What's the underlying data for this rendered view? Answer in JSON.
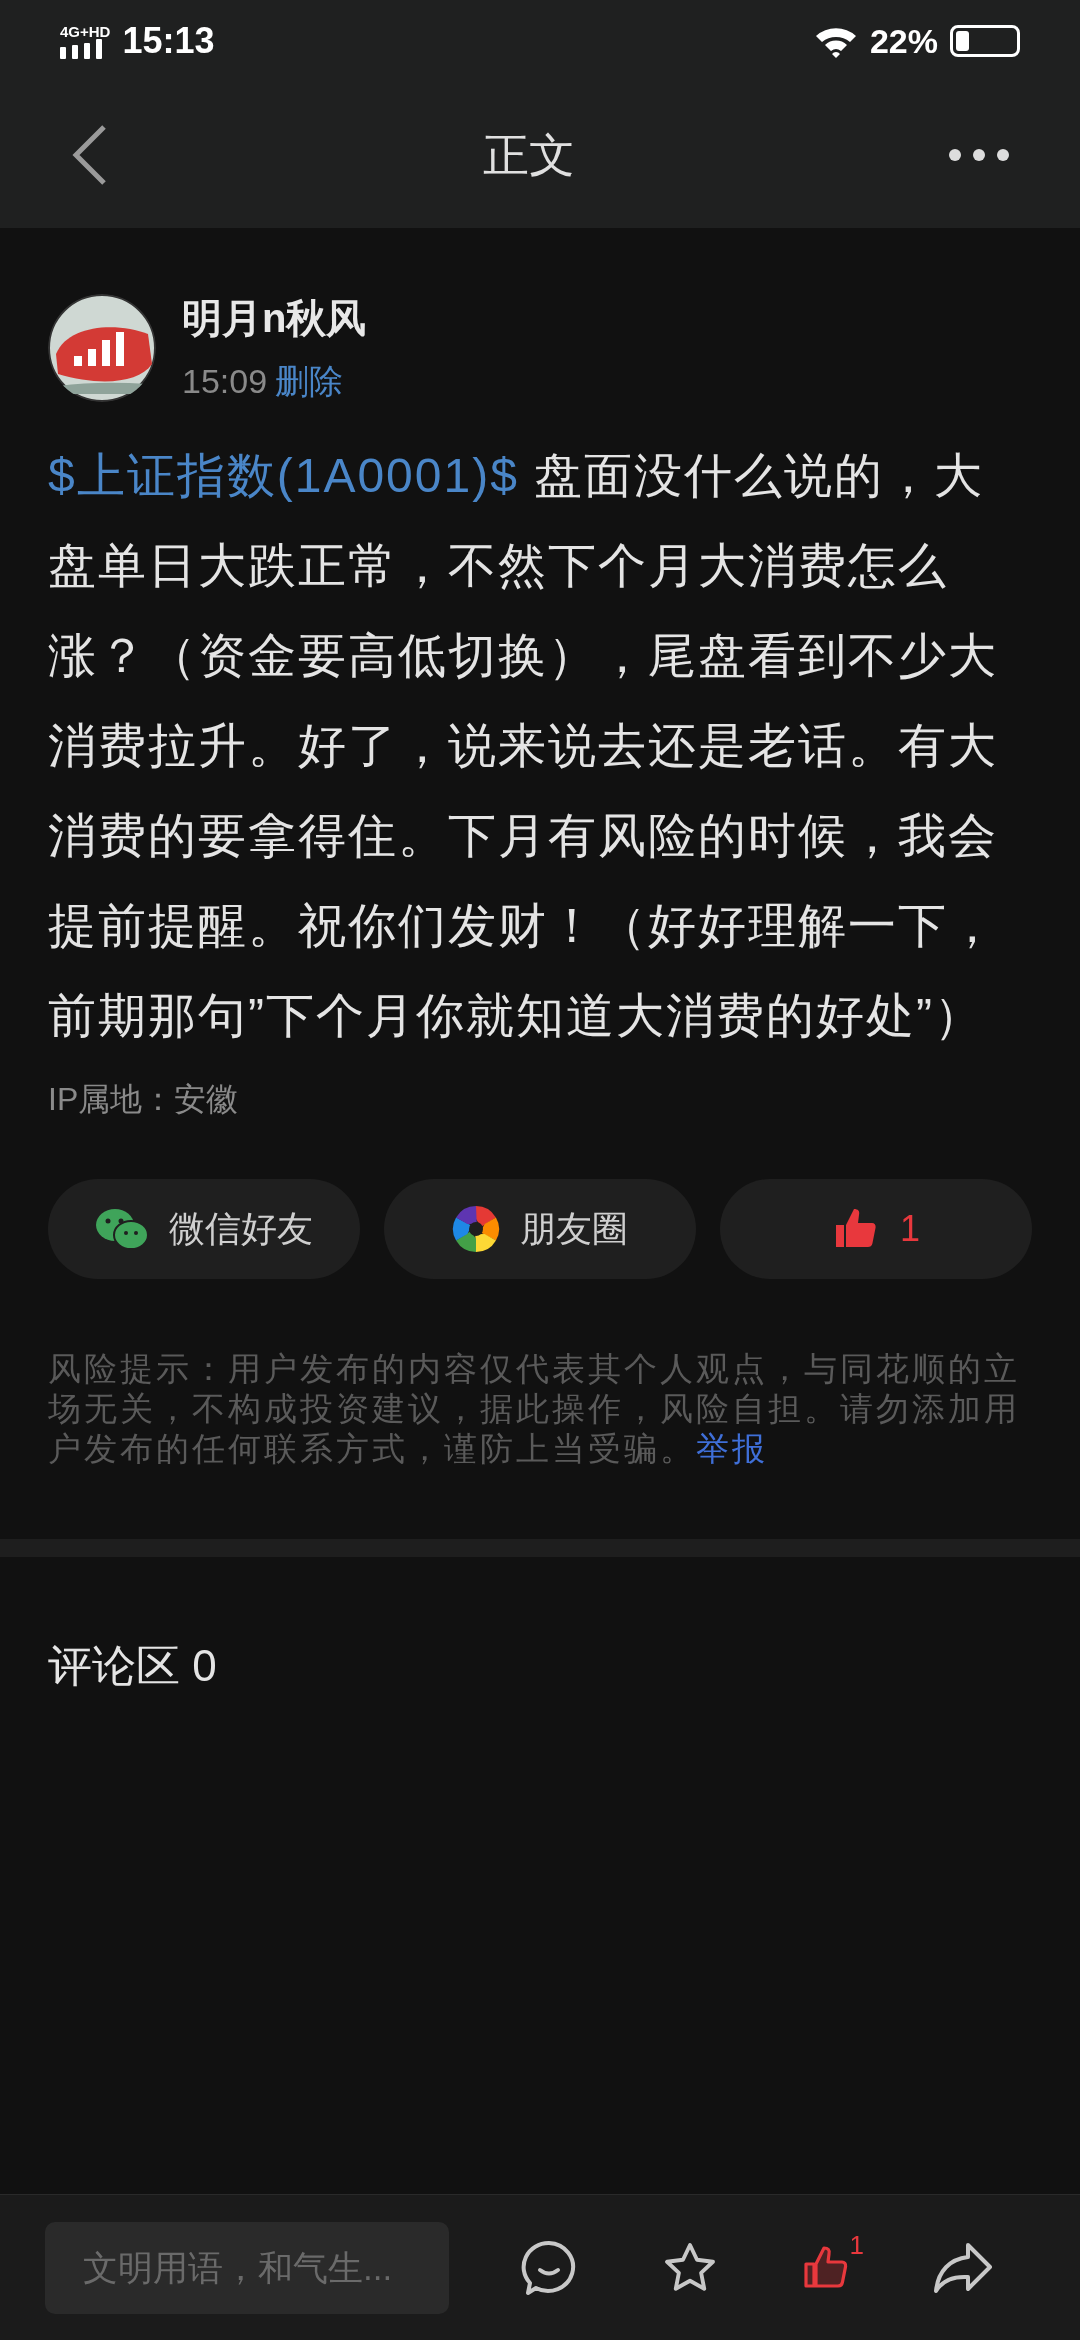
{
  "status_bar": {
    "network": "4G+HD",
    "time": "15:13",
    "battery": "22%"
  },
  "header": {
    "title": "正文"
  },
  "author": {
    "name": "明月n秋风",
    "time": "15:09",
    "delete": "删除"
  },
  "post": {
    "stock_link": "$上证指数(1A0001)$",
    "body": " 盘面没什么说的，大盘单日大跌正常，不然下个月大消费怎么涨？（资金要高低切换），尾盘看到不少大消费拉升。好了，说来说去还是老话。有大消费的要拿得住。下月有风险的时候，我会提前提醒。祝你们发财！（好好理解一下，前期那句”下个月你就知道大消费的好处”）",
    "ip": "IP属地：安徽"
  },
  "share_buttons": [
    {
      "kind": "wechat",
      "label": "微信好友"
    },
    {
      "kind": "moments",
      "label": "朋友圈"
    },
    {
      "kind": "like",
      "label": "1",
      "liked": true
    }
  ],
  "risk_notice": {
    "text": "风险提示：用户发布的内容仅代表其个人观点，与同花顺的立场无关，不构成投资建议，据此操作，风险自担。请勿添加用户发布的任何联系方式，谨防上当受骗。",
    "report": "举报"
  },
  "comments": {
    "title": "评论区 0"
  },
  "bottom_bar": {
    "placeholder": "文明用语，和气生...",
    "like_count": "1",
    "liked": true
  }
}
